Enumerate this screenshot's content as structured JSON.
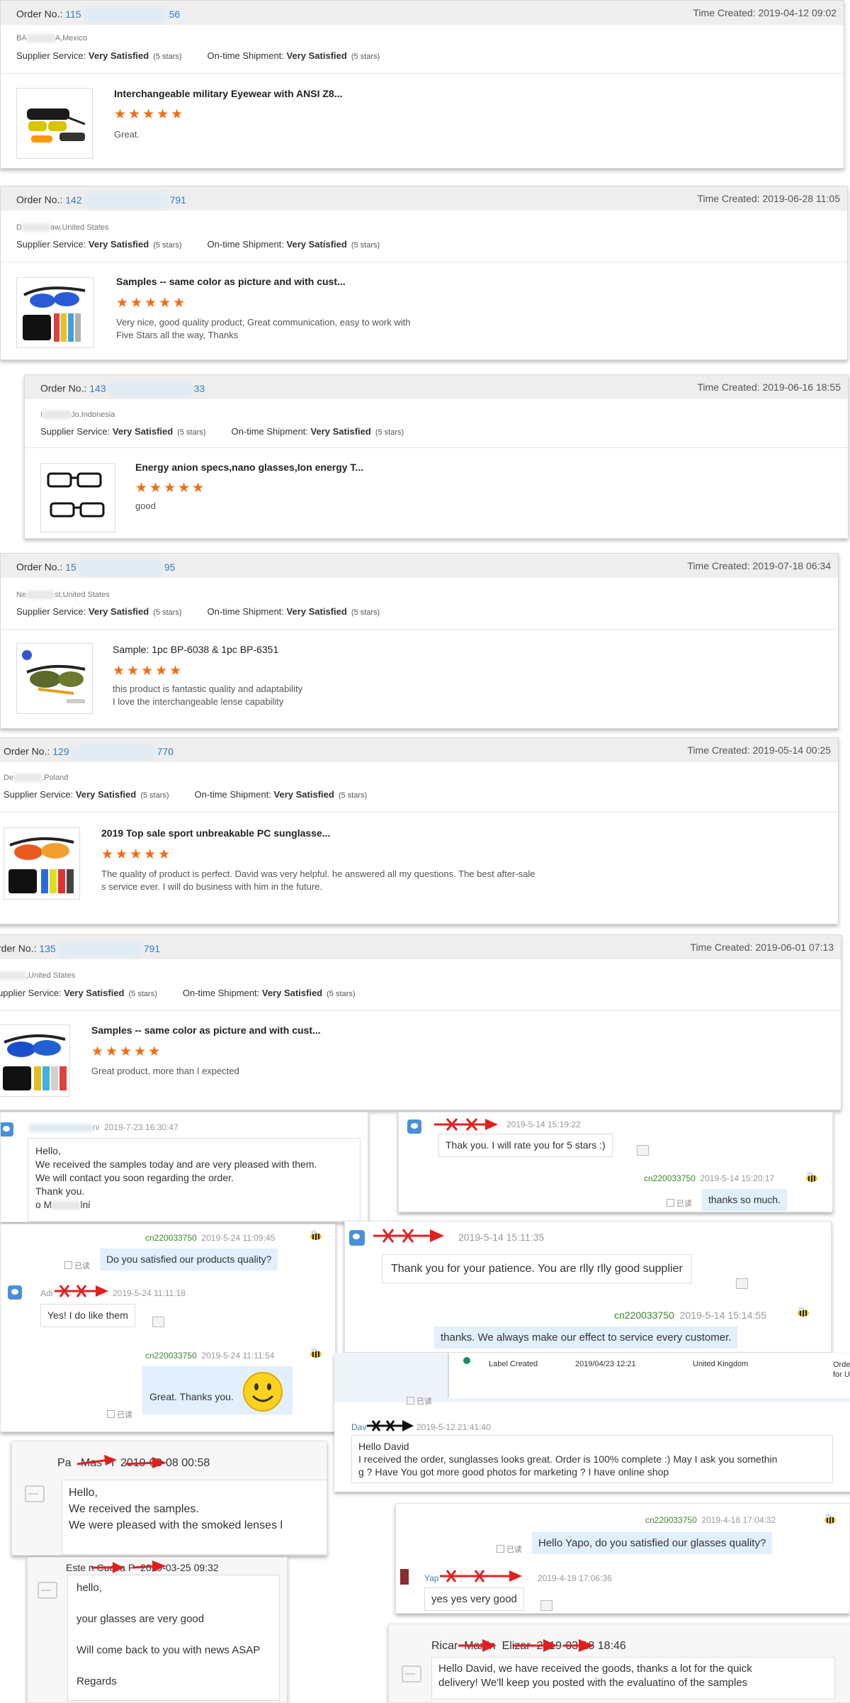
{
  "orders": [
    {
      "order_label": "Order No.:",
      "order_prefix": "115",
      "order_suffix": "56",
      "time": "Time Created: 2019-04-12 09:02",
      "loc_prefix": "BA",
      "loc_suffix": "A,Mexico",
      "supplier_label": "Supplier Service:",
      "supplier_value": "Very Satisfied",
      "supplier_stars": "(5 stars)",
      "shipment_label": "On-time Shipment:",
      "shipment_value": "Very Satisfied",
      "shipment_stars": "(5 stars)",
      "title": "Interchangeable military Eyewear with ANSI Z8...",
      "stars": "★★★★★",
      "review": "Great."
    },
    {
      "order_label": "Order No.:",
      "order_prefix": "142",
      "order_suffix": "791",
      "time": "Time Created: 2019-06-28 11:05",
      "loc_prefix": "D",
      "loc_suffix": "aw,United States",
      "supplier_label": "Supplier Service:",
      "supplier_value": "Very Satisfied",
      "supplier_stars": "(5 stars)",
      "shipment_label": "On-time Shipment:",
      "shipment_value": "Very Satisfied",
      "shipment_stars": "(5 stars)",
      "title": "Samples -- same color as picture and with cust...",
      "stars": "★★★★★",
      "review": "Very nice, good quality product, Great communication, easy to work with\nFive Stars all the way, Thanks"
    },
    {
      "order_label": "Order No.:",
      "order_prefix": "143",
      "order_suffix": "33",
      "time": "Time Created: 2019-06-16 18:55",
      "loc_prefix": "I",
      "loc_suffix": "Jo,Indonesia",
      "supplier_label": "Supplier Service:",
      "supplier_value": "Very Satisfied",
      "supplier_stars": "(5 stars)",
      "shipment_label": "On-time Shipment:",
      "shipment_value": "Very Satisfied",
      "shipment_stars": "(5 stars)",
      "title": "Energy anion specs,nano glasses,Ion energy T...",
      "stars": "★★★★★",
      "review": "good"
    },
    {
      "order_label": "Order No.:",
      "order_prefix": "15",
      "order_suffix": "95",
      "time": "Time Created: 2019-07-18 06:34",
      "loc_prefix": "Ne",
      "loc_suffix": "st,United States",
      "supplier_label": "Supplier Service:",
      "supplier_value": "Very Satisfied",
      "supplier_stars": "(5 stars)",
      "shipment_label": "On-time Shipment:",
      "shipment_value": "Very Satisfied",
      "shipment_stars": "(5 stars)",
      "title": "Sample: 1pc BP-6038 & 1pc BP-6351",
      "stars": "★★★★★",
      "review": "this product is fantastic quality and adaptability\nI love the interchangeable lense capability"
    },
    {
      "order_label": "Order No.:",
      "order_prefix": "129",
      "order_suffix": "770",
      "time": "Time Created: 2019-05-14 00:25",
      "loc_prefix": "De",
      "loc_suffix": ",Poland",
      "supplier_label": "Supplier Service:",
      "supplier_value": "Very Satisfied",
      "supplier_stars": "(5 stars)",
      "shipment_label": "On-time Shipment:",
      "shipment_value": "Very Satisfied",
      "shipment_stars": "(5 stars)",
      "title": "2019 Top sale sport unbreakable PC sunglasse...",
      "stars": "★★★★★",
      "review": "The quality of product is perfect. David was very helpful. he answered all my questions. The best after-sale\ns service ever. I will do business with him in the future."
    },
    {
      "order_label": "rder No.:",
      "order_prefix": "135",
      "order_suffix": "791",
      "time": "Time Created: 2019-06-01 07:13",
      "loc_prefix": "",
      "loc_suffix": ",United States",
      "supplier_label": "upplier Service:",
      "supplier_value": "Very Satisfied",
      "supplier_stars": "(5 stars)",
      "shipment_label": "On-time Shipment:",
      "shipment_value": "Very Satisfied",
      "shipment_stars": "(5 stars)",
      "title": "Samples -- same color as picture and with cust...",
      "stars": "★★★★★",
      "review": "Great product, more than I expected"
    }
  ],
  "chats": {
    "c1": {
      "name_suffix": "ni",
      "time": "2019-7-23 16:30:47",
      "msg": "Hello,\nWe received the samples today and are very pleased with them.\nWe will contact you soon regarding the order.\nThank you.",
      "sign_prefix": "o M",
      "sign_suffix": "lni"
    },
    "c2": {
      "time1": "2019-5-14 15:19:22",
      "msg1": "Thak you. I will rate you for 5 stars :)",
      "me": "cn220033750",
      "time2": "2019-5-14 15:20:17",
      "read": "已读",
      "msg2": "thanks so much."
    },
    "c3": {
      "me": "cn220033750",
      "time1": "2019-5-24 11:09:45",
      "read": "已读",
      "msg1": "Do you satisfied our products quality?",
      "name_prefix": "Adi",
      "time2": "2019-5-24 11:11:18",
      "msg2": "Yes! I do like them",
      "time3": "2019-5-24 11:11:54",
      "msg3": "Great. Thanks you.",
      "read2": "已读"
    },
    "c4": {
      "time1": "2019-5-14 15:11:35",
      "msg1": "Thank you for your patience. You are rlly rlly good supplier",
      "me": "cn220033750",
      "time2": "2019-5-14 15:14:55",
      "msg2": "thanks. We always make our effect to service every customer."
    },
    "c5": {
      "col1": "Label Created",
      "col2": "2019/04/23  12:21",
      "col3": "United Kingdom",
      "col4a": "Order P",
      "col4b": "for UPS",
      "read": "已读",
      "name_prefix": "Dav",
      "time": "2019-5-12 21:41:40",
      "msg": "Hello David\nI received the order, sunglasses looks great. Order is 100% complete :) May I ask you somethin\ng ? Have You got more good photos for marketing ? I have online shop"
    },
    "c6": {
      "name_prefix": "Pa",
      "name_mid": "Mas",
      "name_suffix": "l",
      "time": "2019-03-08 00:58",
      "msg": "Hello,\nWe received the samples.\nWe were pleased with the smoked lenses l"
    },
    "c7": {
      "me": "cn220033750",
      "time1": "2019-4-18 17:04:32",
      "read": "已读",
      "msg1": "Hello Yapo, do you satisfied our glasses quality?",
      "name_prefix": "Yap",
      "time2": "2019-4-18 17:06:36",
      "msg2": "yes yes very good"
    },
    "c8": {
      "name_prefix": "Este",
      "name_mid": "n Cueva",
      "name_suffix": "P",
      "time": "2019-03-25 09:32",
      "l1": "hello,",
      "l2": "your glasses are very good",
      "l3": "Will come back to you with news ASAP",
      "l4": "Regards"
    },
    "c9": {
      "name_prefix": "Ricar",
      "name_mid": "Martin",
      "name_suffix": "Elizar",
      "time": "2019-03-18 18:46",
      "msg": "Hello David, we have received the goods, thanks a lot for the quick\ndelivery! We'll keep you posted with the evaluatino of the samples"
    }
  },
  "colors": {
    "accent": "#f06d15",
    "link": "#2c7dd1",
    "me": "#3a8a2c",
    "bubble": "#e1efff"
  }
}
